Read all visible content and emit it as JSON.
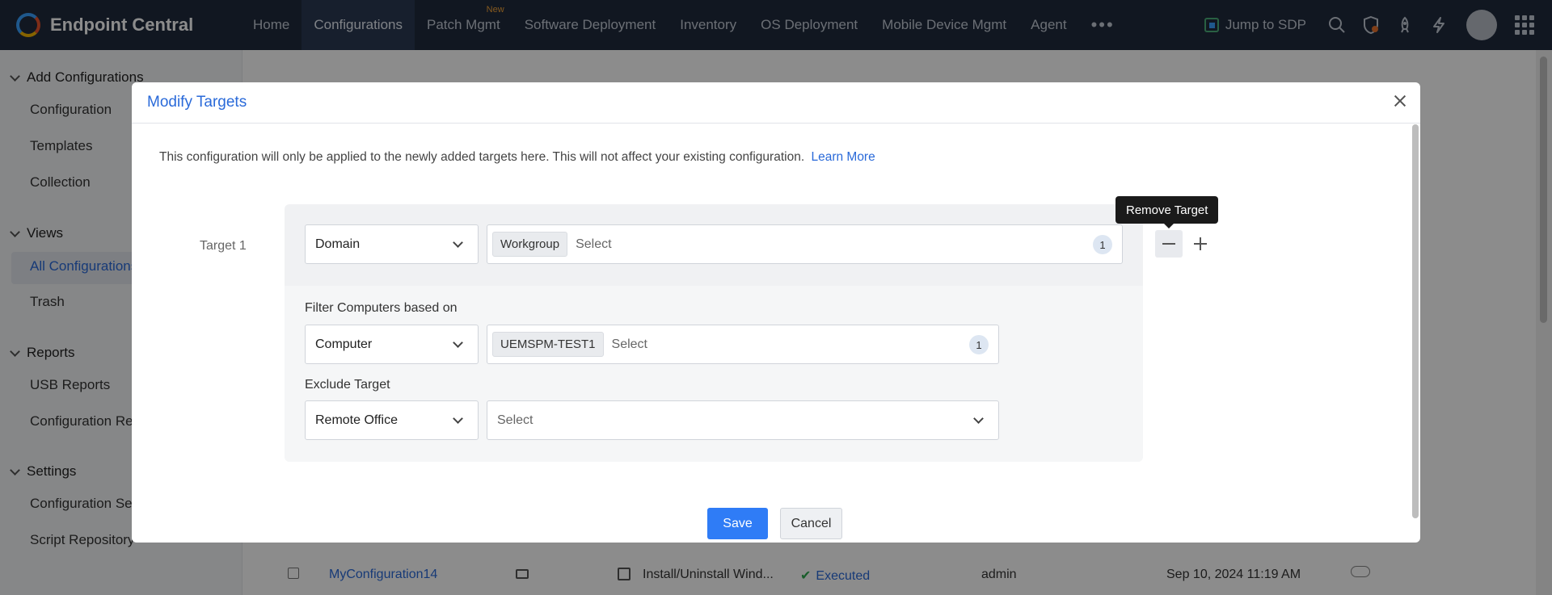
{
  "app": {
    "title": "Endpoint Central"
  },
  "nav": {
    "items": [
      "Home",
      "Configurations",
      "Patch Mgmt",
      "Software Deployment",
      "Inventory",
      "OS Deployment",
      "Mobile Device Mgmt",
      "Agent"
    ],
    "active": "Configurations",
    "new_badge": "New",
    "more": "•••",
    "jump": "Jump to SDP"
  },
  "sidebar": {
    "add_configurations": "Add Configurations",
    "configuration": "Configuration",
    "templates": "Templates",
    "collection": "Collection",
    "views": "Views",
    "all_configurations": "All Configurations",
    "trash": "Trash",
    "reports": "Reports",
    "usb_reports": "USB Reports",
    "configuration_reports": "Configuration Reports",
    "settings": "Settings",
    "configuration_settings": "Configuration Settings",
    "script_repository": "Script Repository"
  },
  "background_row": {
    "name": "MyConfiguration14",
    "type": "Install/Uninstall Wind...",
    "status": "Executed",
    "user": "admin",
    "date": "Sep 10, 2024 11:19 AM"
  },
  "modal": {
    "title": "Modify Targets",
    "info": "This configuration will only be applied to the newly added targets here. This will not affect your existing configuration.",
    "learn_more": "Learn More",
    "target_label": "Target 1",
    "target_type": "Domain",
    "target_chip": "Workgroup",
    "target_placeholder": "Select",
    "target_count": "1",
    "filter_label": "Filter Computers based on",
    "filter_type": "Computer",
    "filter_chip": "UEMSPM-TEST1",
    "filter_placeholder": "Select",
    "filter_count": "1",
    "exclude_label": "Exclude Target",
    "exclude_type": "Remote Office",
    "exclude_placeholder": "Select",
    "tooltip": "Remove Target",
    "save": "Save",
    "cancel": "Cancel"
  }
}
